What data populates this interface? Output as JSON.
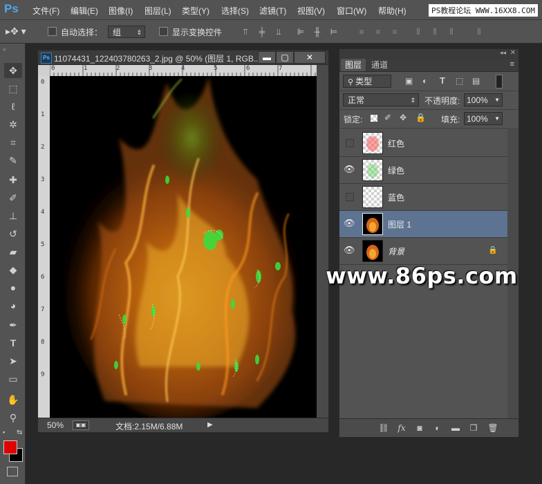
{
  "app": {
    "logo": "Ps",
    "watermark": "PS教程论坛 WWW.16XX8.COM"
  },
  "menu": [
    "文件(F)",
    "编辑(E)",
    "图像(I)",
    "图层(L)",
    "类型(Y)",
    "选择(S)",
    "滤镜(T)",
    "视图(V)",
    "窗口(W)",
    "帮助(H)"
  ],
  "options": {
    "auto_select_label": "自动选择：",
    "auto_select_value": "组",
    "show_transform_label": "显示变换控件"
  },
  "document": {
    "title": "11074431_122403780263_2.jpg @ 50% (图层 1, RGB...",
    "ruler_top": [
      "0",
      "1",
      "2",
      "3",
      "4",
      "5",
      "6",
      "7"
    ],
    "ruler_left": [
      "0",
      "1",
      "2",
      "3",
      "4",
      "5",
      "6",
      "7",
      "8",
      "9"
    ],
    "zoom": "50%",
    "doc_size": "文档:2.15M/6.88M"
  },
  "layers_panel": {
    "tabs": [
      "图层",
      "通道"
    ],
    "filter_kind": "类型",
    "blend_mode": "正常",
    "opacity_label": "不透明度:",
    "opacity_value": "100%",
    "lock_label": "锁定:",
    "fill_label": "填充:",
    "fill_value": "100%",
    "layers": [
      {
        "name": "红色",
        "visible": false,
        "thumb": "checker-red"
      },
      {
        "name": "绿色",
        "visible": true,
        "thumb": "checker-green"
      },
      {
        "name": "蓝色",
        "visible": false,
        "thumb": "checker"
      },
      {
        "name": "图层 1",
        "visible": true,
        "thumb": "fire",
        "selected": true
      },
      {
        "name": "背景",
        "visible": true,
        "thumb": "fire",
        "locked": true
      }
    ]
  },
  "site_watermark": "www.86ps.com"
}
